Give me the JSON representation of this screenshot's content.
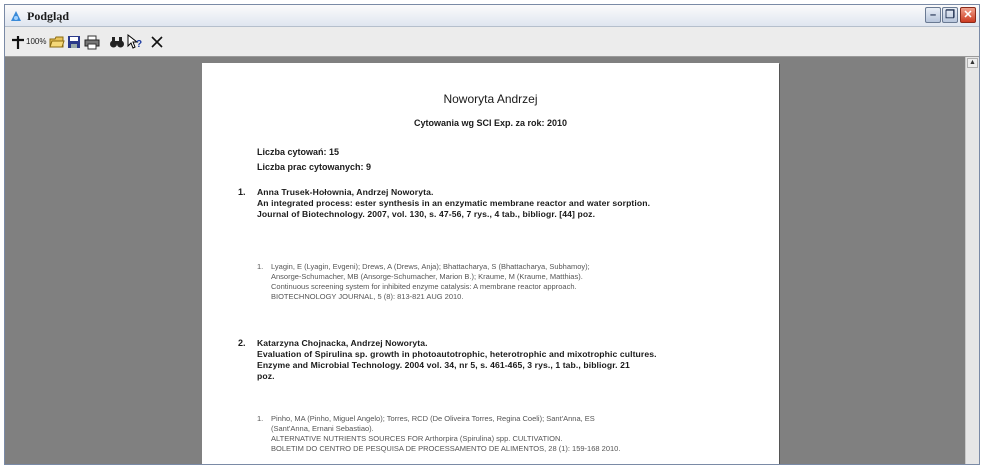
{
  "window": {
    "title": "Podgląd"
  },
  "toolbar": {
    "zoom_label": "100%"
  },
  "document": {
    "title": "Noworyta Andrzej",
    "subtitle": "Cytowania wg SCI Exp. za rok:  2010",
    "stats": [
      {
        "text": "Liczba cytowań:  15"
      },
      {
        "text": "Liczba prac cytowanych:  9"
      }
    ],
    "entries": [
      {
        "number": "1.",
        "lines": [
          "Anna Trusek-Hołownia, Andrzej Noworyta.",
          "An integrated process: ester synthesis in an enzymatic membrane reactor and water sorption.",
          "Journal of Biotechnology. 2007, vol. 130, s. 47-56, 7 rys., 4 tab., bibliogr. [44] poz."
        ],
        "citation": {
          "number": "1.",
          "lines": [
            "Lyagin, E (Lyagin, Evgeni); Drews, A (Drews, Anja); Bhattacharya, S (Bhattacharya, Subhamoy);",
            "Ansorge-Schumacher, MB (Ansorge-Schumacher, Marion B.); Kraume, M (Kraume, Matthias).",
            "Continuous screening system for inhibited enzyme catalysis: A membrane reactor approach.",
            "BIOTECHNOLOGY JOURNAL, 5 (8): 813-821 AUG 2010."
          ]
        }
      },
      {
        "number": "2.",
        "lines": [
          "Katarzyna Chojnacka, Andrzej Noworyta.",
          "Evaluation of Spirulina sp. growth in photoautotrophic, heterotrophic and mixotrophic cultures.",
          "Enzyme and Microbial Technology. 2004 vol. 34, nr 5, s. 461-465, 3 rys., 1 tab., bibliogr. 21",
          "poz."
        ],
        "citation": {
          "number": "1.",
          "lines": [
            "Pinho, MA (Pinho, Miguel Angelo); Torres, RCD (De Oliveira Torres, Regina Coeli); Sant'Anna, ES",
            "(Sant'Anna, Ernani Sebastiao).",
            "ALTERNATIVE NUTRIENTS SOURCES FOR Arthorpira (Spirulina) spp. CULTIVATION.",
            "BOLETIM DO CENTRO DE PESQUISA DE PROCESSAMENTO DE ALIMENTOS, 28 (1): 159-168 2010."
          ]
        }
      }
    ]
  }
}
